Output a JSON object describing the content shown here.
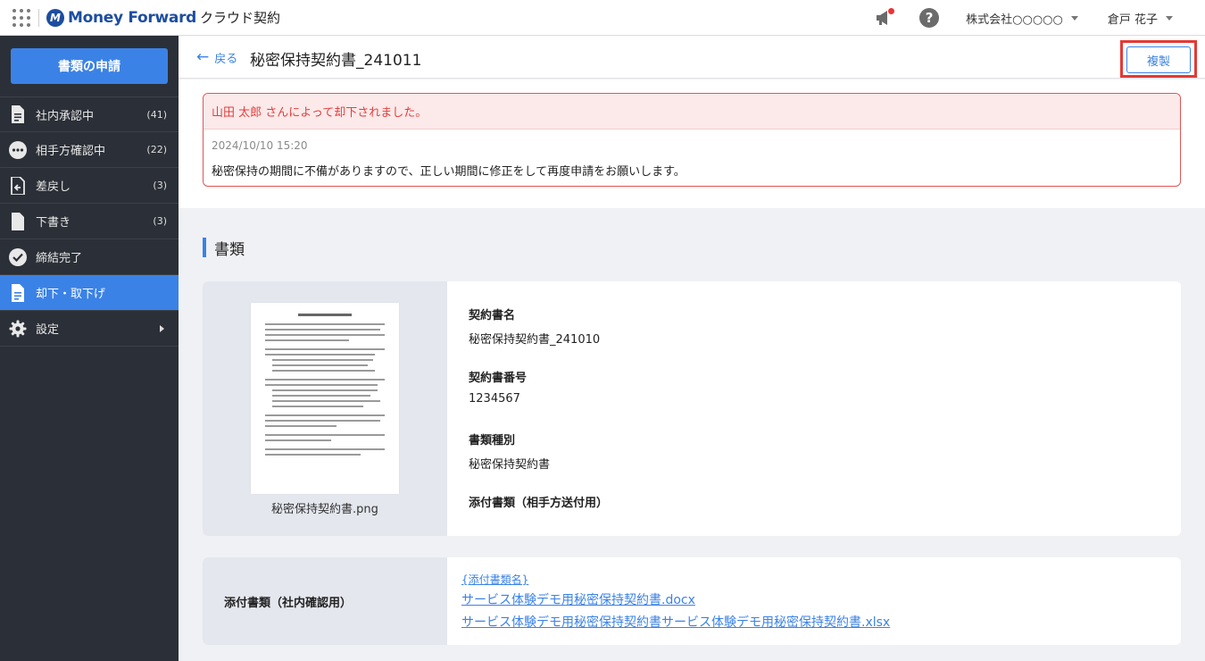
{
  "header": {
    "logo_mark": "M",
    "logo_text": "Money Forward",
    "product": "クラウド契約",
    "company": "株式会社○○○○○",
    "user": "倉戸 花子"
  },
  "sidebar": {
    "apply_button": "書類の申請",
    "items": [
      {
        "label": "社内承認中",
        "count": "(41)",
        "icon": "document-icon"
      },
      {
        "label": "相手方確認中",
        "count": "(22)",
        "icon": "more-dots-icon"
      },
      {
        "label": "差戻し",
        "count": "(3)",
        "icon": "return-document-icon"
      },
      {
        "label": "下書き",
        "count": "(3)",
        "icon": "draft-document-icon"
      },
      {
        "label": "締結完了",
        "count": "",
        "icon": "check-circle-icon"
      },
      {
        "label": "却下・取下げ",
        "count": "",
        "icon": "document-icon",
        "active": true
      },
      {
        "label": "設定",
        "count": "",
        "icon": "gear-icon"
      }
    ]
  },
  "page": {
    "back_label": "戻る",
    "title": "秘密保持契約書_241011",
    "duplicate_button": "複製"
  },
  "notice": {
    "message": "山田 太郎 さんによって却下されました。",
    "timestamp": "2024/10/10  15:20",
    "comment": "秘密保持の期間に不備がありますので、正しい期間に修正をして再度申請をお願いします。"
  },
  "documents": {
    "section_title": "書類",
    "file_name": "秘密保持契約書.png",
    "contract_name_label": "契約書名",
    "contract_name": "秘密保持契約書_241010",
    "contract_number_label": "契約書番号",
    "contract_number": "1234567",
    "doc_type_label": "書類種別",
    "doc_type": "秘密保持契約書",
    "attachments_partner_label": "添付書類（相手方送付用）"
  },
  "internal_attachments": {
    "label": "添付書類（社内確認用）",
    "links": [
      "{添付書類名}",
      "サービス体験デモ用秘密保持契約書.docx",
      "サービス体験デモ用秘密保持契約書サービス体験デモ用秘密保持契約書.xlsx"
    ]
  },
  "colors": {
    "brand": "#1d4da0",
    "accent": "#3b82e6",
    "sidebar_bg": "#2b2f37",
    "danger": "#e0403f"
  }
}
